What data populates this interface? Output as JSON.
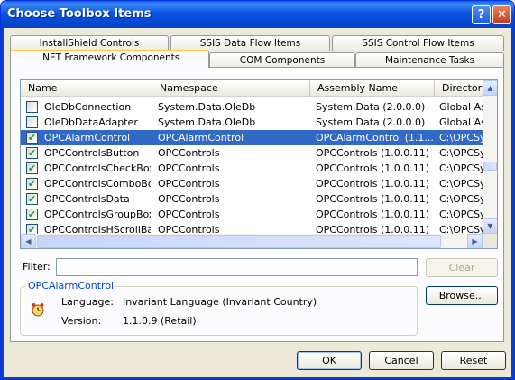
{
  "window": {
    "title": "Choose Toolbox Items",
    "help_label": "?",
    "close_label": "✕"
  },
  "tabs_row1": [
    "InstallShield Controls",
    "SSIS Data Flow Items",
    "SSIS Control Flow Items"
  ],
  "tabs_row2": [
    ".NET Framework Components",
    "COM Components",
    "Maintenance Tasks"
  ],
  "active_tab": ".NET Framework Components",
  "list": {
    "columns": [
      "Name",
      "Namespace",
      "Assembly Name",
      "Directory"
    ],
    "rows": [
      {
        "checked": false,
        "name": "OleDbConnection",
        "namespace": "System.Data.OleDb",
        "assembly": "System.Data (2.0.0.0)",
        "directory": "Global Ass",
        "selected": false
      },
      {
        "checked": false,
        "name": "OleDbDataAdapter",
        "namespace": "System.Data.OleDb",
        "assembly": "System.Data (2.0.0.0)",
        "directory": "Global Ass",
        "selected": false
      },
      {
        "checked": true,
        "name": "OPCAlarmControl",
        "namespace": "OPCAlarmControl",
        "assembly": "OPCAlarmControl (1.1....",
        "directory": "C:\\OPCSy",
        "selected": true
      },
      {
        "checked": true,
        "name": "OPCControlsButton",
        "namespace": "OPCControls",
        "assembly": "OPCControls (1.0.0.11)",
        "directory": "C:\\OPCSy",
        "selected": false
      },
      {
        "checked": true,
        "name": "OPCControlsCheckBox",
        "namespace": "OPCControls",
        "assembly": "OPCControls (1.0.0.11)",
        "directory": "C:\\OPCSy",
        "selected": false
      },
      {
        "checked": true,
        "name": "OPCControlsComboBox",
        "namespace": "OPCControls",
        "assembly": "OPCControls (1.0.0.11)",
        "directory": "C:\\OPCSy",
        "selected": false
      },
      {
        "checked": true,
        "name": "OPCControlsData",
        "namespace": "OPCControls",
        "assembly": "OPCControls (1.0.0.11)",
        "directory": "C:\\OPCSy",
        "selected": false
      },
      {
        "checked": true,
        "name": "OPCControlsGroupBox",
        "namespace": "OPCControls",
        "assembly": "OPCControls (1.0.0.11)",
        "directory": "C:\\OPCSy",
        "selected": false
      },
      {
        "checked": true,
        "name": "OPCControlsHScrollBar",
        "namespace": "OPCControls",
        "assembly": "OPCControls (1.0.0.11)",
        "directory": "C:\\OPCSy",
        "selected": false
      }
    ]
  },
  "filter": {
    "label": "Filter:",
    "value": "",
    "clear_label": "Clear"
  },
  "details": {
    "group_title": "OPCAlarmControl",
    "language_label": "Language:",
    "language_value": "Invariant Language (Invariant Country)",
    "version_label": "Version:",
    "version_value": "1.1.0.9 (Retail)"
  },
  "buttons": {
    "browse": "Browse...",
    "ok": "OK",
    "cancel": "Cancel",
    "reset": "Reset"
  },
  "colors": {
    "title_bar": "#0a54e0",
    "selection": "#316ac5",
    "group_title": "#0046d5"
  }
}
